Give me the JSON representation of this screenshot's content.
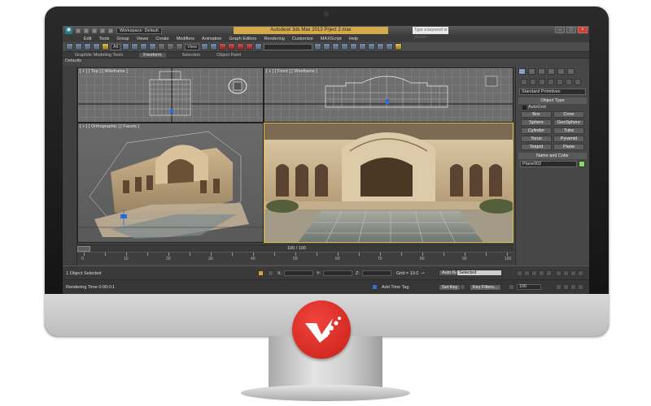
{
  "window": {
    "title": "Autodesk 3ds Max  2013      Prject 2.max",
    "workspace": "Workspace: Default",
    "search_placeholder": "Type a keyword or phrase",
    "app_logo": "3ds-max-logo",
    "title_color": "#d4a94b"
  },
  "menu": [
    "Edit",
    "Tools",
    "Group",
    "Views",
    "Create",
    "Modifiers",
    "Animation",
    "Graph Editors",
    "Rendering",
    "Customize",
    "MAXScript",
    "Help"
  ],
  "toolbar": {
    "selection_filter": "All",
    "coord_system": "View"
  },
  "ribbon": {
    "tabs": [
      "Graphite Modeling Tools",
      "Freeform",
      "Selection",
      "Object Paint"
    ],
    "active": "Freeform",
    "panel_label": "Defaults"
  },
  "viewports": {
    "top": "[ + ] [ Top ] [ Wireframe ]",
    "front": "[ + ] [ Front ] [ Wireframe ]",
    "perspective": "[ + ] [ Orthographic ] [ Facets ]"
  },
  "command_panel": {
    "dropdown": "Standard Primitives",
    "object_type_header": "Object Type",
    "autogrid": "AutoGrid",
    "buttons": [
      "Box",
      "Cone",
      "Sphere",
      "GeoSphere",
      "Cylinder",
      "Tube",
      "Torus",
      "Pyramid",
      "Teapot",
      "Plane"
    ],
    "name_color_header": "Name and Color",
    "object_name": "Plane002",
    "object_color": "#8cd96b"
  },
  "timeline": {
    "frame_counter": "100 / 100",
    "ticks": [
      "0",
      "5",
      "10",
      "15",
      "20",
      "25",
      "30",
      "35",
      "40",
      "45",
      "50",
      "55",
      "60",
      "65",
      "70",
      "75",
      "80",
      "85",
      "90",
      "95",
      "100"
    ]
  },
  "status": {
    "selection": "1 Object Selected",
    "render_time": "Rendering Time  0:00:0:1",
    "x_label": "X:",
    "y_label": "Y:",
    "z_label": "Z:",
    "grid": "Grid = 10.0",
    "add_time_tag": "Add Time Tag",
    "auto_key": "Auto Key",
    "set_key": "Set Key",
    "key_mode": "Selected",
    "key_filters": "Key Filters...",
    "frame": "100"
  },
  "brand": {
    "badge_color": "#e0332c"
  }
}
